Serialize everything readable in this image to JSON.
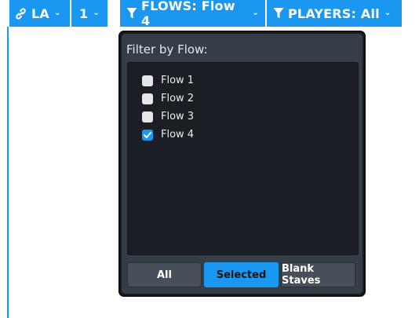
{
  "toolbar": {
    "link_segment": {
      "label": "LA",
      "icon": "link-icon"
    },
    "number_segment": {
      "label": "1"
    },
    "flows_segment": {
      "label": "FLOWS: Flow 4",
      "icon": "filter-icon"
    },
    "players_segment": {
      "label": "PLAYERS: All",
      "icon": "filter-icon"
    }
  },
  "flow_popup": {
    "title": "Filter by Flow:",
    "items": [
      {
        "label": "Flow 1",
        "checked": false
      },
      {
        "label": "Flow 2",
        "checked": false
      },
      {
        "label": "Flow 3",
        "checked": false
      },
      {
        "label": "Flow 4",
        "checked": true
      }
    ],
    "buttons": {
      "all": "All",
      "selected": "Selected",
      "blank_staves": "Blank Staves"
    }
  },
  "colors": {
    "accent": "#1a97f0",
    "popup_bg": "#353d46",
    "list_bg": "#1b1f25"
  }
}
